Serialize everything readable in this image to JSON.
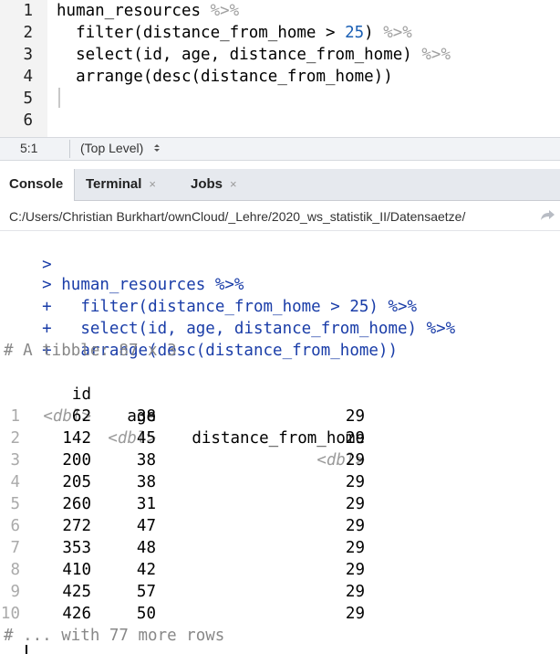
{
  "editor": {
    "lines": [
      {
        "n": "1",
        "parts": [
          {
            "t": "human_resources ",
            "c": ""
          },
          {
            "t": "%>%",
            "c": "pipe"
          }
        ]
      },
      {
        "n": "2",
        "parts": [
          {
            "t": "  filter(distance_from_home > ",
            "c": ""
          },
          {
            "t": "25",
            "c": "num"
          },
          {
            "t": ") ",
            "c": ""
          },
          {
            "t": "%>%",
            "c": "pipe"
          }
        ]
      },
      {
        "n": "3",
        "parts": [
          {
            "t": "  select(id, age, distance_from_home) ",
            "c": ""
          },
          {
            "t": "%>%",
            "c": "pipe"
          }
        ]
      },
      {
        "n": "4",
        "parts": [
          {
            "t": "  arrange(desc(distance_from_home))",
            "c": ""
          }
        ]
      },
      {
        "n": "5",
        "parts": []
      },
      {
        "n": "6",
        "parts": []
      }
    ]
  },
  "status": {
    "position": "5:1",
    "scope": "(Top Level)",
    "scope_icon": "updown-chevron-icon"
  },
  "tabs": [
    {
      "label": "Console",
      "active": true,
      "closable": false
    },
    {
      "label": "Terminal",
      "active": false,
      "closable": true
    },
    {
      "label": "Jobs",
      "active": false,
      "closable": true
    }
  ],
  "close_glyph": "×",
  "path": {
    "text": "C:/Users/Christian Burkhart/ownCloud/_Lehre/2020_ws_statistik_II/Datensaetze/",
    "icon": "goto-directory-arrow-icon"
  },
  "console": {
    "prompt": ">",
    "continuation": "+",
    "commands": [
      "human_resources %>%",
      "  filter(distance_from_home > 25) %>%",
      "  select(id, age, distance_from_home) %>%",
      "  arrange(desc(distance_from_home))"
    ],
    "tibble_header": "# A tibble: 87 x 3",
    "columns": [
      "id",
      "age",
      "distance_from_home"
    ],
    "types": [
      "<dbl>",
      "<dbl>",
      "<dbl>"
    ],
    "rows": [
      [
        "1",
        "62",
        "38",
        "29"
      ],
      [
        "2",
        "142",
        "45",
        "29"
      ],
      [
        "3",
        "200",
        "38",
        "29"
      ],
      [
        "4",
        "205",
        "38",
        "29"
      ],
      [
        "5",
        "260",
        "31",
        "29"
      ],
      [
        "6",
        "272",
        "47",
        "29"
      ],
      [
        "7",
        "353",
        "48",
        "29"
      ],
      [
        "8",
        "410",
        "42",
        "29"
      ],
      [
        "9",
        "425",
        "57",
        "29"
      ],
      [
        "10",
        "426",
        "50",
        "29"
      ]
    ],
    "footer": "# ... with 77 more rows"
  }
}
